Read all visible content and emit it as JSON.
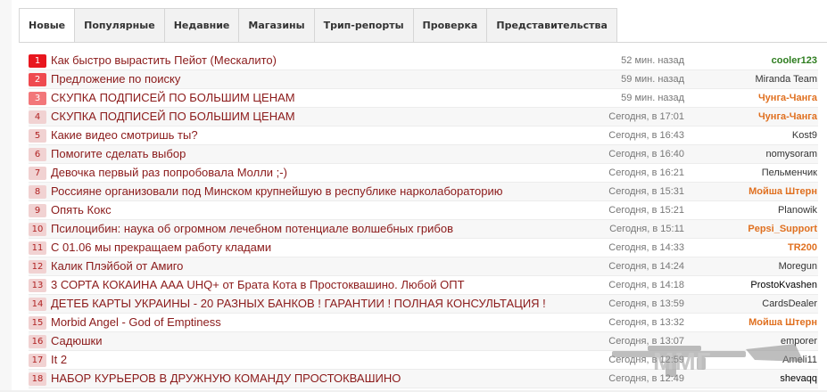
{
  "tabs": [
    {
      "label": "Новые",
      "active": true
    },
    {
      "label": "Популярные"
    },
    {
      "label": "Недавние"
    },
    {
      "label": "Магазины"
    },
    {
      "label": "Трип-репорты"
    },
    {
      "label": "Проверка"
    },
    {
      "label": "Представительства"
    }
  ],
  "topics": [
    {
      "num": "1",
      "title": "Как быстро вырастить Пейот (Мескалито)",
      "time": "52 мин. назад",
      "user": "cooler123",
      "user_color": "#2e7d1f",
      "user_bold": true
    },
    {
      "num": "2",
      "title": "Предложение по поиску",
      "time": "59 мин. назад",
      "user": "Miranda Team",
      "user_color": "#333333",
      "user_bold": false
    },
    {
      "num": "3",
      "title": "СКУПКА ПОДПИСЕЙ ПО БОЛЬШИМ ЦЕНАМ",
      "time": "59 мин. назад",
      "user": "Чунга-Чанга",
      "user_color": "#e07020",
      "user_bold": true
    },
    {
      "num": "4",
      "title": "СКУПКА ПОДПИСЕЙ ПО БОЛЬШИМ ЦЕНАМ",
      "time": "Сегодня, в 17:01",
      "user": "Чунга-Чанга",
      "user_color": "#e07020",
      "user_bold": true
    },
    {
      "num": "5",
      "title": "Какие видео смотришь ты?",
      "time": "Сегодня, в 16:43",
      "user": "Kost9",
      "user_color": "#333333",
      "user_bold": false
    },
    {
      "num": "6",
      "title": "Помогите сделать выбор",
      "time": "Сегодня, в 16:40",
      "user": "nomysoram",
      "user_color": "#333333",
      "user_bold": false
    },
    {
      "num": "7",
      "title": "Девочка первый раз попробовала Молли ;-)",
      "time": "Сегодня, в 16:21",
      "user": "Пельменчик",
      "user_color": "#333333",
      "user_bold": false
    },
    {
      "num": "8",
      "title": "Россияне организовали под Минском крупнейшую в республике нарколабораторию",
      "time": "Сегодня, в 15:31",
      "user": "Мойша Штерн",
      "user_color": "#e07020",
      "user_bold": true
    },
    {
      "num": "9",
      "title": "Опять Кокс",
      "time": "Сегодня, в 15:21",
      "user": "Planowik",
      "user_color": "#333333",
      "user_bold": false
    },
    {
      "num": "10",
      "title": "Псилоцибин: наука об огромном лечебном потенциале волшебных грибов",
      "time": "Сегодня, в 15:11",
      "user": "Pepsi_Support",
      "user_color": "#e07020",
      "user_bold": true
    },
    {
      "num": "11",
      "title": "С 01.06 мы прекращаем работу кладами",
      "time": "Сегодня, в 14:33",
      "user": "TR200",
      "user_color": "#e07020",
      "user_bold": true
    },
    {
      "num": "12",
      "title": "Калик Плэйбой от Амиго",
      "time": "Сегодня, в 14:24",
      "user": "Moregun",
      "user_color": "#333333",
      "user_bold": false
    },
    {
      "num": "13",
      "title": "3 СОРТА КОКАИНА ААА UHQ+ от Брата Кота в Простоквашино. Любой ОПТ",
      "time": "Сегодня, в 14:18",
      "user": "ProstoKvashen",
      "user_color": "#000000",
      "user_bold": false
    },
    {
      "num": "14",
      "title": "ДЕТЕБ КАРТЫ УКРАИНЫ - 20 РАЗНЫХ БАНКОВ ! ГАРАНТИИ ! ПОЛНАЯ КОНСУЛЬТАЦИЯ !",
      "time": "Сегодня, в 13:59",
      "user": "CardsDealer",
      "user_color": "#333333",
      "user_bold": false
    },
    {
      "num": "15",
      "title": "Morbid Angel - God of Emptiness",
      "time": "Сегодня, в 13:32",
      "user": "Мойша Штерн",
      "user_color": "#e07020",
      "user_bold": true
    },
    {
      "num": "16",
      "title": "Садюшки",
      "time": "Сегодня, в 13:07",
      "user": "emporer",
      "user_color": "#333333",
      "user_bold": false
    },
    {
      "num": "17",
      "title": "It 2",
      "time": "Сегодня, в 12:59",
      "user": "Ameli11",
      "user_color": "#333333",
      "user_bold": false
    },
    {
      "num": "18",
      "title": "НАБОР КУРЬЕРОВ В ДРУЖНУЮ КОМАНДУ ПРОСТОКВАШИНО",
      "time": "Сегодня, в 12:49",
      "user": "shevaqq",
      "user_color": "#000000",
      "user_bold": false
    }
  ],
  "watermark": {
    "text": "ММГ"
  }
}
